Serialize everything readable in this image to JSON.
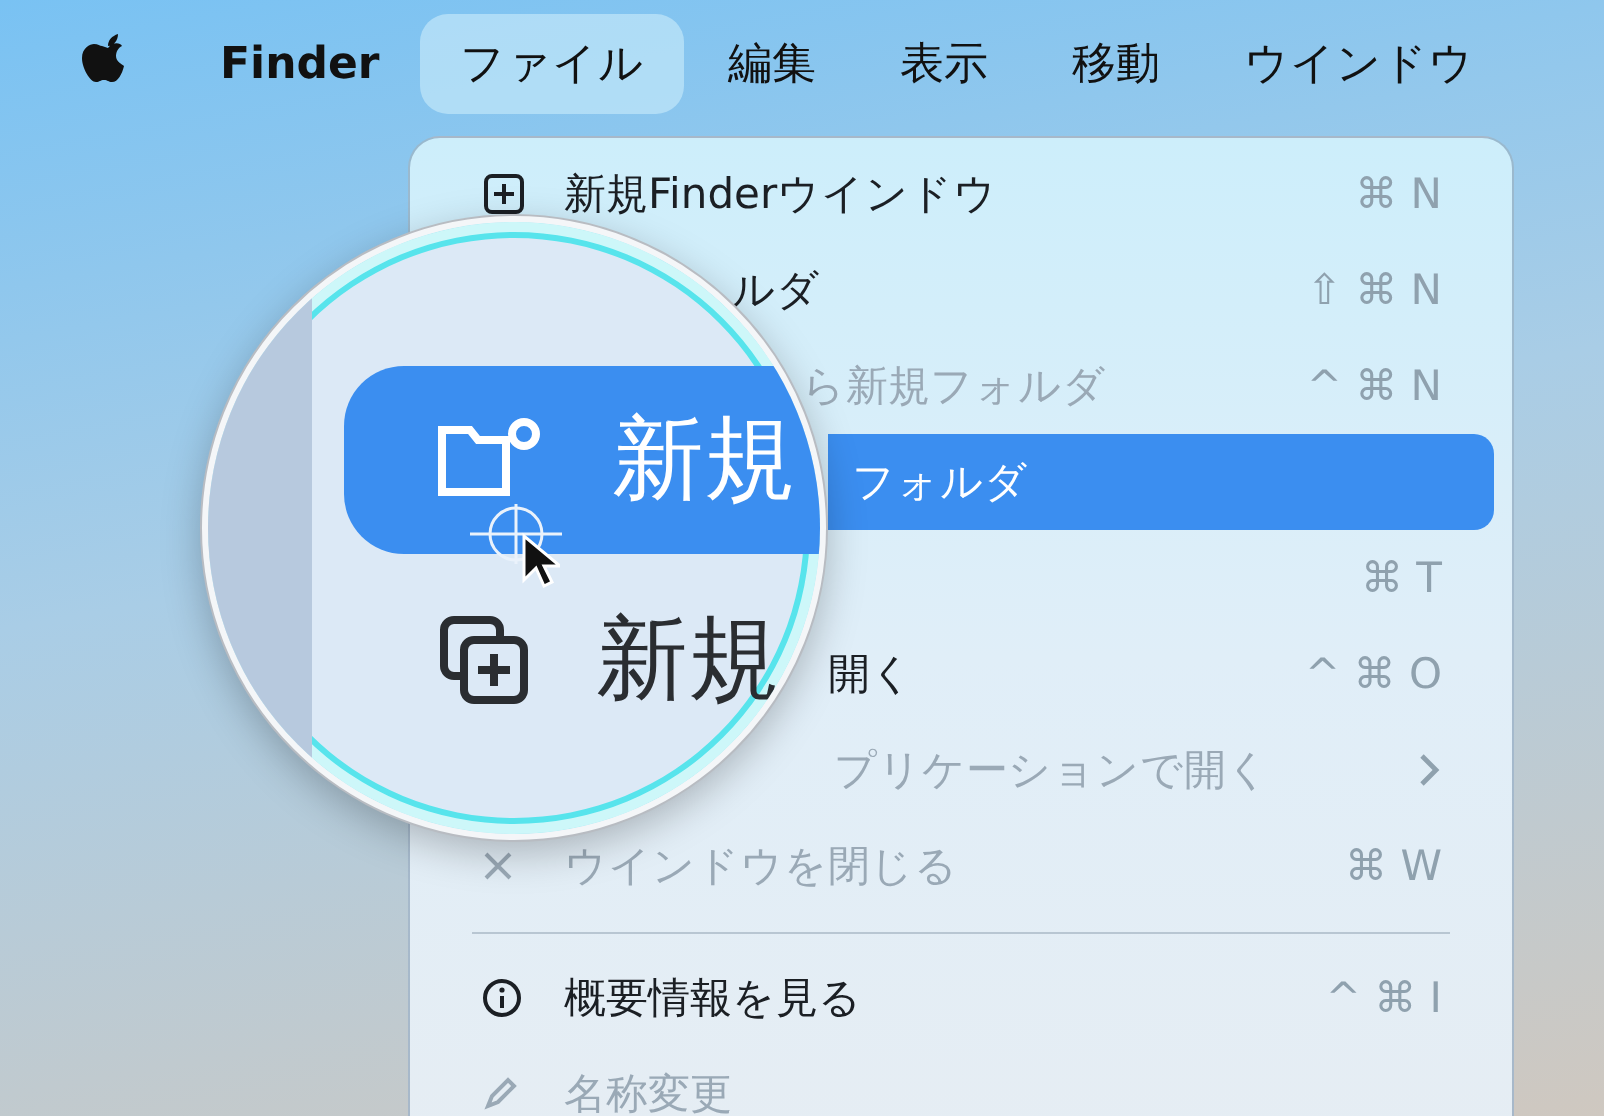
{
  "menu_bar": {
    "items": [
      {
        "label": "Finder",
        "kind": "app",
        "selected": false
      },
      {
        "label": "ファイル",
        "kind": "menu",
        "selected": true
      },
      {
        "label": "編集",
        "kind": "menu",
        "selected": false
      },
      {
        "label": "表示",
        "kind": "menu",
        "selected": false
      },
      {
        "label": "移動",
        "kind": "menu",
        "selected": false
      },
      {
        "label": "ウインドウ",
        "kind": "menu",
        "selected": false
      }
    ]
  },
  "menu": {
    "items": [
      {
        "kind": "item",
        "label": "新規Finderウインドウ",
        "shortcut": "⌘ N",
        "disabled": false,
        "selected": false
      },
      {
        "kind": "item",
        "label": "ルダ",
        "shortcut": "⇧ ⌘ N",
        "disabled": false,
        "selected": false
      },
      {
        "kind": "item",
        "label": "ら新規フォルダ",
        "shortcut": "^ ⌘ N",
        "disabled": true,
        "selected": false
      },
      {
        "kind": "item",
        "label": "フォルダ",
        "disabled": false,
        "selected": true
      },
      {
        "kind": "item",
        "shortcut": "⌘ T",
        "selected": false
      },
      {
        "kind": "item",
        "label": "開く",
        "shortcut": "^ ⌘ O",
        "disabled": false,
        "selected": false
      },
      {
        "kind": "submenu",
        "label": "プリケーションで開く",
        "disabled": true,
        "selected": false
      },
      {
        "kind": "item",
        "label": "ウインドウを閉じる",
        "shortcut": "⌘ W",
        "disabled": true,
        "selected": false
      },
      {
        "kind": "separator"
      },
      {
        "kind": "item",
        "label": "概要情報を見る",
        "shortcut": "^ ⌘ I",
        "disabled": false,
        "selected": false
      },
      {
        "kind": "item",
        "label": "名称変更",
        "disabled": true,
        "selected": false
      }
    ]
  },
  "magnifier": {
    "rows": [
      {
        "label": "新規",
        "selected": true
      },
      {
        "label": "新規",
        "selected": false
      }
    ]
  }
}
